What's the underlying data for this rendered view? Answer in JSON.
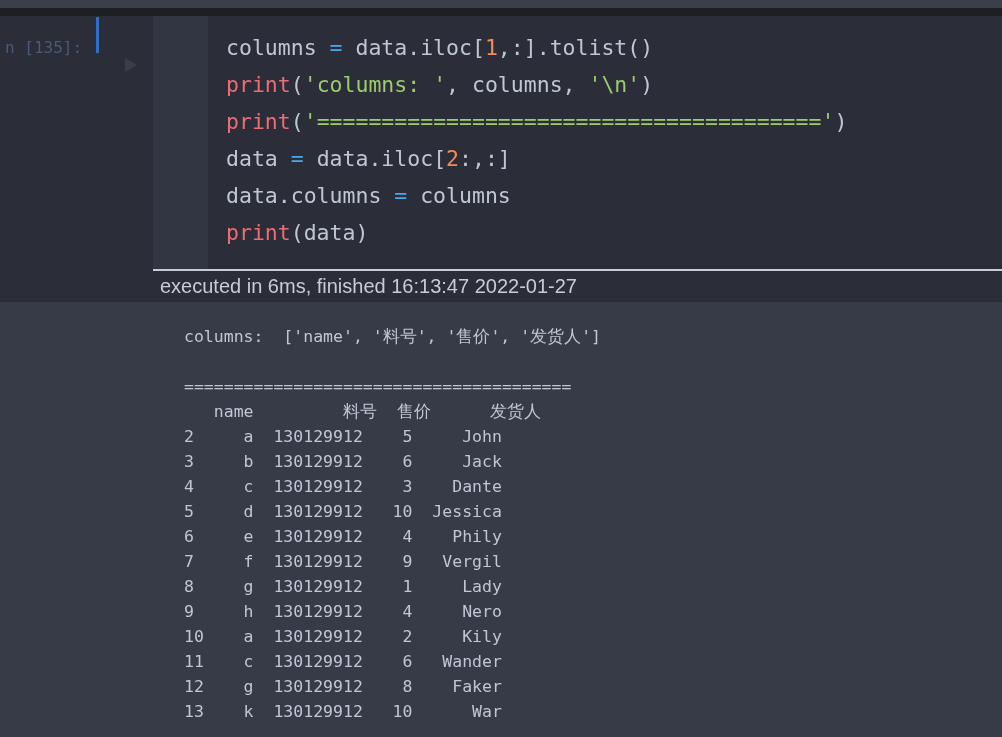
{
  "cell": {
    "prompt": "n [135]:",
    "selected": true,
    "code_lines": [
      [
        {
          "kind": "plain",
          "text": "columns "
        },
        {
          "kind": "op",
          "text": "="
        },
        {
          "kind": "plain",
          "text": " data.iloc["
        },
        {
          "kind": "num",
          "text": "1"
        },
        {
          "kind": "plain",
          "text": ",:].tolist()"
        }
      ],
      [
        {
          "kind": "kw",
          "text": "print"
        },
        {
          "kind": "plain",
          "text": "("
        },
        {
          "kind": "str",
          "text": "'columns: '"
        },
        {
          "kind": "plain",
          "text": ", columns, "
        },
        {
          "kind": "str",
          "text": "'\\n'"
        },
        {
          "kind": "plain",
          "text": ")"
        }
      ],
      [
        {
          "kind": "kw",
          "text": "print"
        },
        {
          "kind": "plain",
          "text": "("
        },
        {
          "kind": "str",
          "text": "'======================================='"
        },
        {
          "kind": "plain",
          "text": ")"
        }
      ],
      [
        {
          "kind": "plain",
          "text": "data "
        },
        {
          "kind": "op",
          "text": "="
        },
        {
          "kind": "plain",
          "text": " data.iloc["
        },
        {
          "kind": "num",
          "text": "2"
        },
        {
          "kind": "plain",
          "text": ":,:]"
        }
      ],
      [
        {
          "kind": "plain",
          "text": "data.columns "
        },
        {
          "kind": "op",
          "text": "="
        },
        {
          "kind": "plain",
          "text": " columns"
        }
      ],
      [
        {
          "kind": "kw",
          "text": "print"
        },
        {
          "kind": "plain",
          "text": "(data)"
        }
      ]
    ],
    "execution_info": "executed in 6ms, finished 16:13:47 2022-01-27",
    "output_blocks": [
      [
        "columns:  ['name', '料号', '售价', '发货人']"
      ],
      [
        "=======================================",
        "   name         料号  售价      发货人",
        "2     a  130129912    5     John",
        "3     b  130129912    6     Jack",
        "4     c  130129912    3    Dante",
        "5     d  130129912   10  Jessica",
        "6     e  130129912    4    Phily",
        "7     f  130129912    9   Vergil",
        "8     g  130129912    1     Lady",
        "9     h  130129912    4     Nero",
        "10    a  130129912    2     Kily",
        "11    c  130129912    6   Wander",
        "12    g  130129912    8    Faker",
        "13    k  130129912   10      War"
      ]
    ]
  }
}
